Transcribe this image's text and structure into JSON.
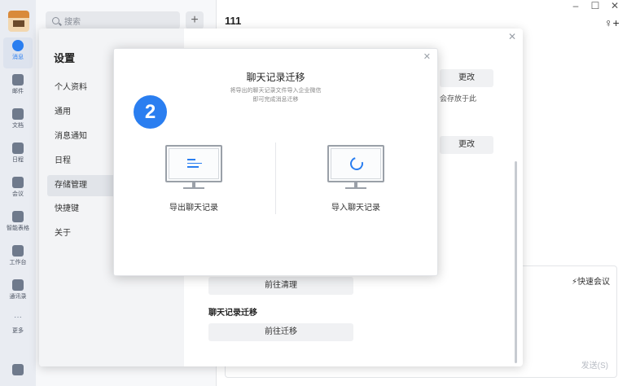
{
  "nav": {
    "items": [
      {
        "label": "消息",
        "icon": "chat-bubble-icon",
        "active": true
      },
      {
        "label": "邮件",
        "icon": "mail-icon"
      },
      {
        "label": "文档",
        "icon": "document-icon"
      },
      {
        "label": "日程",
        "icon": "calendar-icon"
      },
      {
        "label": "会议",
        "icon": "meeting-icon"
      },
      {
        "label": "智能表格",
        "icon": "smart-sheet-icon"
      },
      {
        "label": "工作台",
        "icon": "workbench-icon"
      },
      {
        "label": "通讯录",
        "icon": "contacts-icon"
      },
      {
        "label": "更多",
        "icon": "more-icon"
      }
    ]
  },
  "sessions": {
    "search_placeholder": "搜索",
    "add_label": "+"
  },
  "chat": {
    "title": "111",
    "window_controls": {
      "minimize": "–",
      "maximize": "☐",
      "close": "✕"
    },
    "quick_meeting": "⚡快速会议",
    "send_hint": "发送(S)"
  },
  "settings": {
    "title": "设置",
    "close": "✕",
    "menu": [
      "个人资料",
      "通用",
      "消息通知",
      "日程",
      "存储管理",
      "快捷键",
      "关于"
    ],
    "active_index": 4,
    "change_label": "更改",
    "storage_note": "会存放于此",
    "cleanup_button": "前往清理",
    "migration_heading": "聊天记录迁移",
    "migration_button": "前往迁移"
  },
  "migrate": {
    "title": "聊天记录迁移",
    "subtitle_line1": "将导出的聊天记录文件导入企业微信",
    "subtitle_line2": "即可完成消息迁移",
    "close": "✕",
    "step_badge": "2",
    "export_label": "导出聊天记录",
    "import_label": "导入聊天记录",
    "accent_color": "#2a7ef0"
  }
}
